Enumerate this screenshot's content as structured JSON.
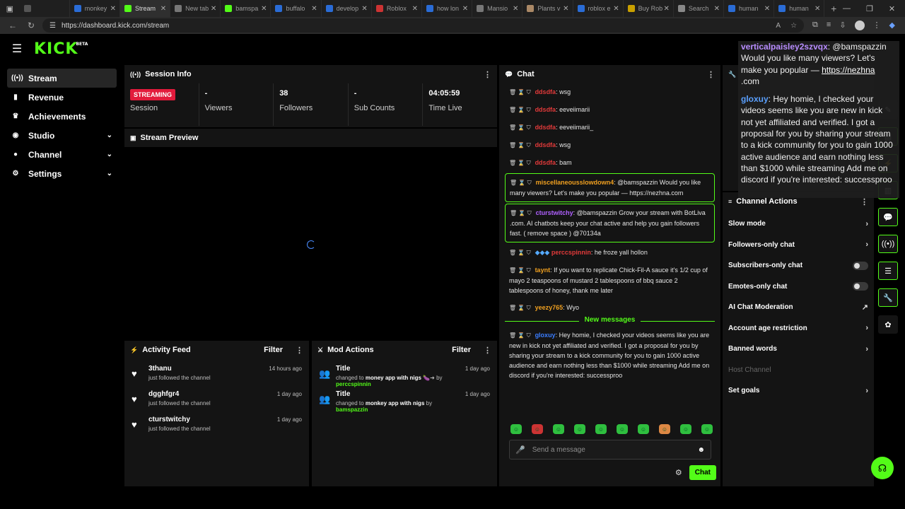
{
  "browser": {
    "tabs": [
      {
        "label": ""
      },
      {
        "label": "monkey"
      },
      {
        "label": "Stream"
      },
      {
        "label": "New tab"
      },
      {
        "label": "bamspa"
      },
      {
        "label": "buffalo"
      },
      {
        "label": "develop"
      },
      {
        "label": "Roblox"
      },
      {
        "label": "how lon"
      },
      {
        "label": "Mansio"
      },
      {
        "label": "Plants v"
      },
      {
        "label": "roblox e"
      },
      {
        "label": "Buy Rob"
      },
      {
        "label": "Search"
      },
      {
        "label": "human"
      },
      {
        "label": "human"
      }
    ],
    "url": "https://dashboard.kick.com/stream"
  },
  "brand": {
    "logo": "KICK",
    "beta": "BETA",
    "accent": "#53fc18"
  },
  "sidebar": {
    "items": [
      {
        "label": "Stream",
        "icon": "stream-icon"
      },
      {
        "label": "Revenue",
        "icon": "revenue-icon"
      },
      {
        "label": "Achievements",
        "icon": "trophy-icon"
      },
      {
        "label": "Studio",
        "icon": "studio-icon"
      },
      {
        "label": "Channel",
        "icon": "channel-icon"
      },
      {
        "label": "Settings",
        "icon": "gear-icon"
      }
    ]
  },
  "session": {
    "title": "Session Info",
    "status_badge": "STREAMING",
    "status_label": "Session",
    "viewers_value": "-",
    "viewers_label": "Viewers",
    "followers_value": "38",
    "followers_label": "Followers",
    "subs_value": "-",
    "subs_label": "Sub Counts",
    "time_value": "04:05:59",
    "time_label": "Time Live"
  },
  "preview": {
    "title": "Stream Preview"
  },
  "activity": {
    "title": "Activity Feed",
    "filter": "Filter",
    "items": [
      {
        "name": "3thanu",
        "sub": "just followed the channel",
        "time": "14 hours ago"
      },
      {
        "name": "dgghfgr4",
        "sub": "just followed the channel",
        "time": "1 day ago"
      },
      {
        "name": "cturstwitchy",
        "sub": "just followed the channel",
        "time": "1 day ago"
      }
    ]
  },
  "mod": {
    "title": "Mod Actions",
    "filter": "Filter",
    "items": [
      {
        "name": "Title",
        "changed": "changed to",
        "value": "money app with nigs",
        "by": "by",
        "user": "perccspinnin",
        "time": "1 day ago"
      },
      {
        "name": "Title",
        "changed": "changed to",
        "value": "monkey app with nigs",
        "by": "by",
        "user": "bamspazzin",
        "time": "1 day ago"
      }
    ]
  },
  "chat": {
    "title": "Chat",
    "messages": [
      {
        "user": "ddsdfa",
        "text": ": wsg",
        "color": "#e23a3a"
      },
      {
        "user": "ddsdfa",
        "text": ": eeveiimarii",
        "color": "#e23a3a"
      },
      {
        "user": "ddsdfa",
        "text": ": eeveiimarii_",
        "color": "#e23a3a"
      },
      {
        "user": "ddsdfa",
        "text": ": wsg",
        "color": "#e23a3a"
      },
      {
        "user": "ddsdfa",
        "text": ": bam",
        "color": "#e23a3a"
      },
      {
        "user": "miscellaneousslowdown4",
        "text": ": @bamspazzin Would you like many viewers? Let's make you popular — https://nezhna.com",
        "color": "#f0a020"
      },
      {
        "user": "cturstwitchy",
        "text": ": @bamspazzin Grow your stream with BotLiva .com. AI chatbots keep your chat active and help you gain followers fast. ( remove space ) @70134a",
        "color": "#b060ff"
      },
      {
        "user": "perccspinnin",
        "text": ": he froze yall hollon",
        "color": "#e23a3a"
      },
      {
        "user": "taynt",
        "text": ": If you want to replicate Chick-Fil-A sauce it's 1/2 cup of mayo 2 teaspoons of mustard 2 tablespoons of bbq sauce 2 tablespoons of honey, thank me later",
        "color": "#f0a020"
      },
      {
        "user": "yeezy765",
        "text": ": Wyo",
        "color": "#f0a020"
      },
      {
        "user": "gloxuy",
        "text": ": Hey homie, I checked your videos seems like you are new in kick not yet affiliated and verified. I got a proposal for you by sharing your stream to a kick community for you to gain 1000 active audience and earn nothing less than $1000 while streaming Add me on discord if you're interested: successproo",
        "color": "#3a7dff"
      }
    ],
    "new_messages": "New messages",
    "placeholder": "Send a message",
    "send": "Chat"
  },
  "actions": {
    "title": "Channel Actions",
    "slow": "Slow mode",
    "followers": "Followers-only chat",
    "subs": "Subscribers-only chat",
    "emotes": "Emotes-only chat",
    "ai": "AI Chat Moderation",
    "age": "Account age restriction",
    "banned": "Banned words",
    "host": "Host Channel",
    "goals": "Set goals"
  },
  "overlay": {
    "user1": "verticalpaisley2szvqx",
    "text1": ": @bamspazzin Would you like many viewers? Let's make you popular — ",
    "link1": "https://nezhna",
    "link1b": ".com",
    "user2": "gloxuy",
    "text2": ": Hey homie, I checked your videos seems like you are new in kick not yet affiliated and verified. I got a proposal for you by sharing your stream to a kick community for you to gain 1000 active audience and earn nothing less than $1000 while streaming Add me on discord if you're interested: successproo"
  }
}
